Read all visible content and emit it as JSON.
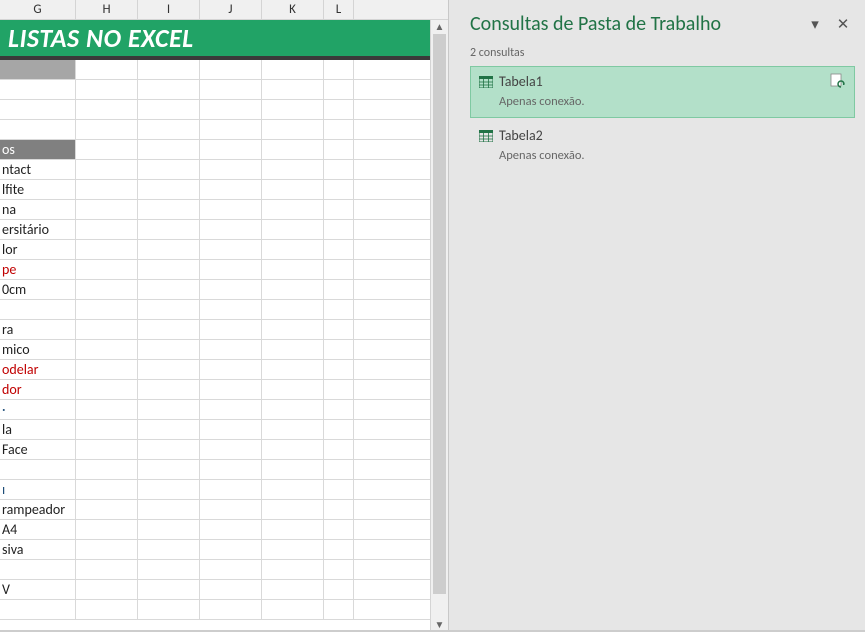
{
  "columns": [
    "G",
    "H",
    "I",
    "J",
    "K",
    "L"
  ],
  "title": "LISTAS NO EXCEL",
  "rows": [
    {
      "text": "",
      "cls": "gray-fill"
    },
    {
      "text": "",
      "cls": ""
    },
    {
      "text": "",
      "cls": ""
    },
    {
      "text": "",
      "cls": ""
    },
    {
      "text": "os",
      "cls": "header-gray"
    },
    {
      "text": "ntact",
      "cls": ""
    },
    {
      "text": "lfite",
      "cls": ""
    },
    {
      "text": "na",
      "cls": ""
    },
    {
      "text": "ersitário",
      "cls": ""
    },
    {
      "text": "lor",
      "cls": ""
    },
    {
      "text": "pe",
      "cls": "red-text"
    },
    {
      "text": "0cm",
      "cls": ""
    },
    {
      "text": "",
      "cls": ""
    },
    {
      "text": "ra",
      "cls": ""
    },
    {
      "text": "mico",
      "cls": ""
    },
    {
      "text": "odelar",
      "cls": "red-text"
    },
    {
      "text": "dor",
      "cls": "red-text"
    },
    {
      "text": "·",
      "cls": "blue-text"
    },
    {
      "text": "la",
      "cls": ""
    },
    {
      "text": " Face",
      "cls": ""
    },
    {
      "text": "",
      "cls": ""
    },
    {
      "text": "ı",
      "cls": "blue-text"
    },
    {
      "text": "rampeador",
      "cls": ""
    },
    {
      "text": "A4",
      "cls": ""
    },
    {
      "text": "siva",
      "cls": ""
    },
    {
      "text": "",
      "cls": ""
    },
    {
      "text": "V",
      "cls": ""
    },
    {
      "text": "",
      "cls": ""
    }
  ],
  "pane": {
    "title": "Consultas de Pasta de Trabalho",
    "subtitle": "2 consultas",
    "queries": [
      {
        "name": "Tabela1",
        "sub": "Apenas conexão.",
        "selected": true
      },
      {
        "name": "Tabela2",
        "sub": "Apenas conexão.",
        "selected": false
      }
    ]
  }
}
